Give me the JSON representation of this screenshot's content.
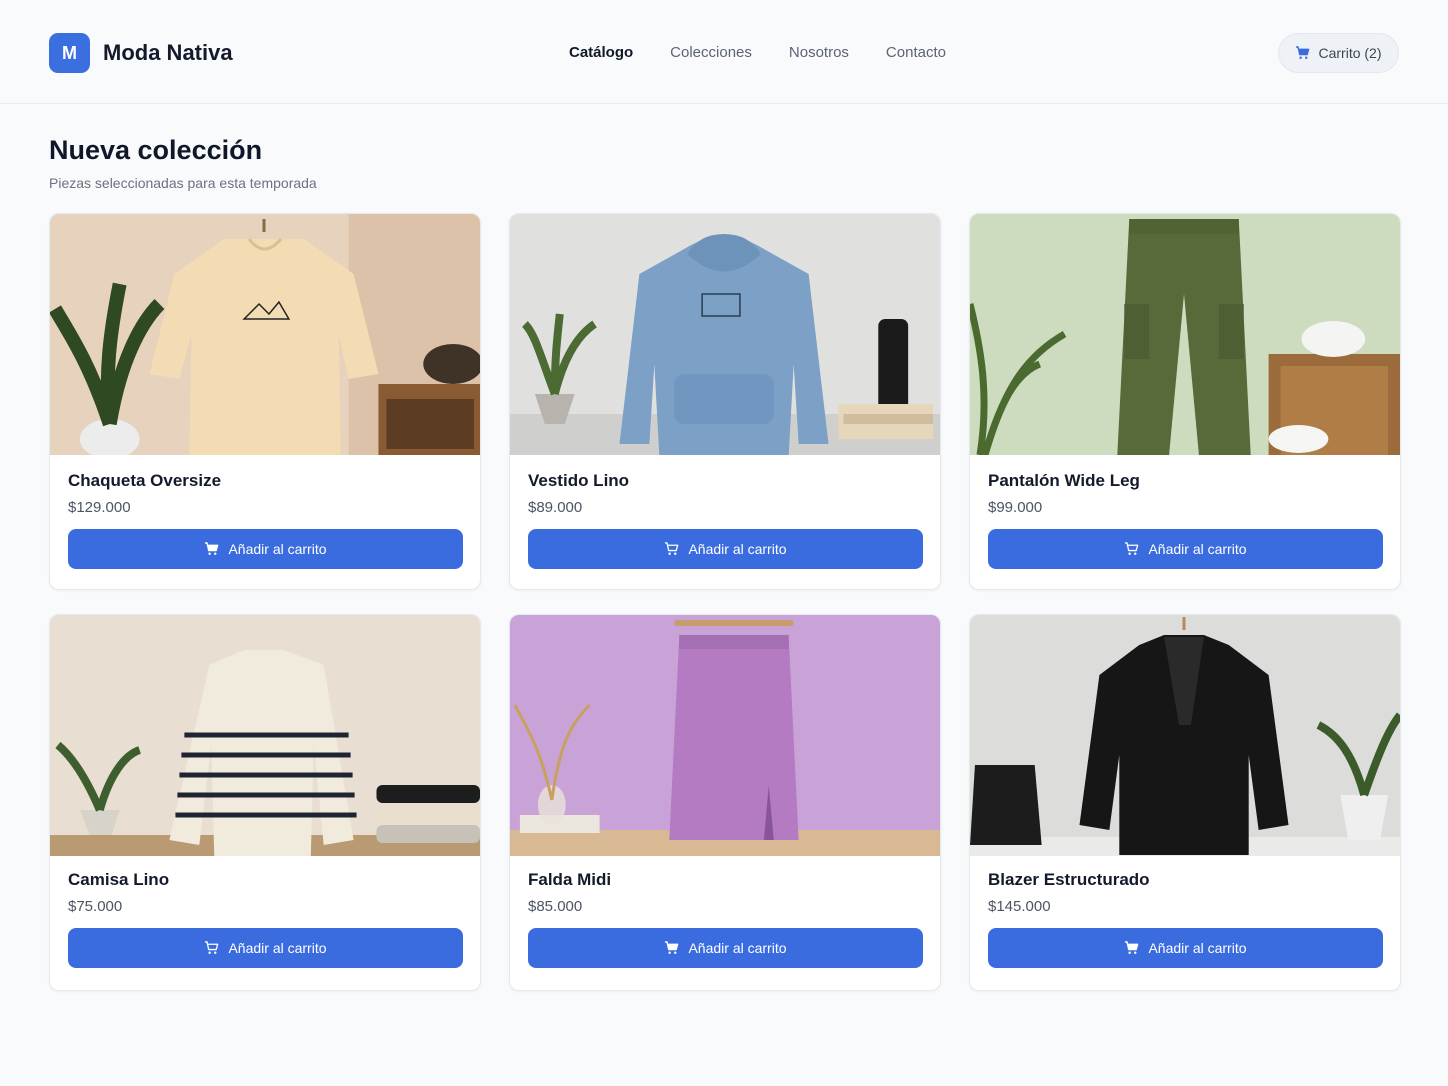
{
  "brand": {
    "mark": "M",
    "name": "Moda Nativa"
  },
  "nav": [
    {
      "label": "Catálogo",
      "active": true
    },
    {
      "label": "Colecciones",
      "active": false
    },
    {
      "label": "Nosotros",
      "active": false
    },
    {
      "label": "Contacto",
      "active": false
    }
  ],
  "cart": {
    "label": "Carrito (2)",
    "icon": "cart-icon"
  },
  "section": {
    "title": "Nueva colección",
    "subtitle": "Piezas seleccionadas para esta temporada"
  },
  "products": [
    {
      "name": "Chaqueta Oversize",
      "price": "$129.000",
      "button": "Añadir al carrito",
      "image": "cream-tshirt-photo",
      "bg": "#e9d6c2"
    },
    {
      "name": "Vestido Lino",
      "price": "$89.000",
      "button": "Añadir al carrito",
      "image": "blue-hoodie-photo",
      "bg": "#dcdcdc"
    },
    {
      "name": "Pantalón Wide Leg",
      "price": "$99.000",
      "button": "Añadir al carrito",
      "image": "olive-cargo-pants-photo",
      "bg": "#cfdcc4"
    },
    {
      "name": "Camisa Lino",
      "price": "$75.000",
      "button": "Añadir al carrito",
      "image": "striped-sweater-photo",
      "bg": "#e6dcd0"
    },
    {
      "name": "Falda Midi",
      "price": "$85.000",
      "button": "Añadir al carrito",
      "image": "purple-skirt-photo",
      "bg": "#c8a3d6"
    },
    {
      "name": "Blazer Estructurado",
      "price": "$145.000",
      "button": "Añadir al carrito",
      "image": "black-blazer-photo",
      "bg": "#e2e2e2"
    }
  ],
  "colors": {
    "accent": "#3a6ce0",
    "logo": "#3b6fe0"
  }
}
